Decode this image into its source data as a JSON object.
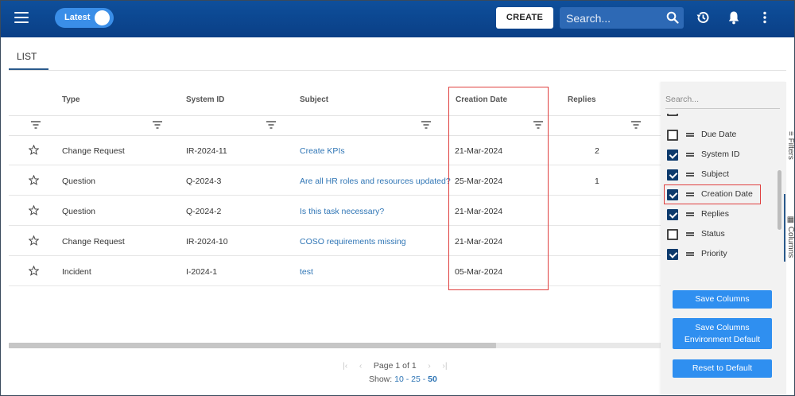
{
  "header": {
    "menu_icon": "hamburger-menu-icon",
    "toggle_label": "Latest",
    "create_label": "CREATE",
    "search_placeholder": "Search...",
    "icons": [
      "search-icon",
      "history-icon",
      "bell-icon",
      "more-vert-icon"
    ]
  },
  "tabs": [
    {
      "label": "LIST",
      "active": true
    }
  ],
  "table": {
    "columns": [
      "Type",
      "System ID",
      "Subject",
      "Creation Date",
      "Replies"
    ],
    "rows": [
      {
        "type": "Change Request",
        "system_id": "IR-2024-11",
        "subject": "Create KPIs",
        "creation_date": "21-Mar-2024",
        "replies": "2"
      },
      {
        "type": "Question",
        "system_id": "Q-2024-3",
        "subject": "Are all HR roles and resources updated?",
        "creation_date": "25-Mar-2024",
        "replies": "1"
      },
      {
        "type": "Question",
        "system_id": "Q-2024-2",
        "subject": "Is this task necessary?",
        "creation_date": "21-Mar-2024",
        "replies": ""
      },
      {
        "type": "Change Request",
        "system_id": "IR-2024-10",
        "subject": "COSO requirements missing",
        "creation_date": "21-Mar-2024",
        "replies": ""
      },
      {
        "type": "Incident",
        "system_id": "I-2024-1",
        "subject": "test",
        "creation_date": "05-Mar-2024",
        "replies": ""
      }
    ]
  },
  "pager": {
    "page_label": "Page",
    "page": "1",
    "of_label": "of",
    "total_pages": "1",
    "show_label": "Show:",
    "sizes": [
      "10",
      "25",
      "50"
    ],
    "selected_size": "50",
    "separator": "-"
  },
  "columns_panel": {
    "search_placeholder": "Search...",
    "items": [
      {
        "label": "Due Date",
        "checked": false
      },
      {
        "label": "System ID",
        "checked": true
      },
      {
        "label": "Subject",
        "checked": true
      },
      {
        "label": "Creation Date",
        "checked": true
      },
      {
        "label": "Replies",
        "checked": true
      },
      {
        "label": "Status",
        "checked": false
      },
      {
        "label": "Priority",
        "checked": true
      }
    ],
    "save_label": "Save Columns",
    "save_env_label_1": "Save Columns",
    "save_env_label_2": "Environment Default",
    "reset_label": "Reset to Default"
  },
  "side_tabs": {
    "filters": "Filters",
    "columns": "Columns"
  },
  "colors": {
    "header": "#0e4f9b",
    "accent": "#2f8ff0",
    "link": "#2f75b5",
    "highlight": "#e0403f"
  }
}
